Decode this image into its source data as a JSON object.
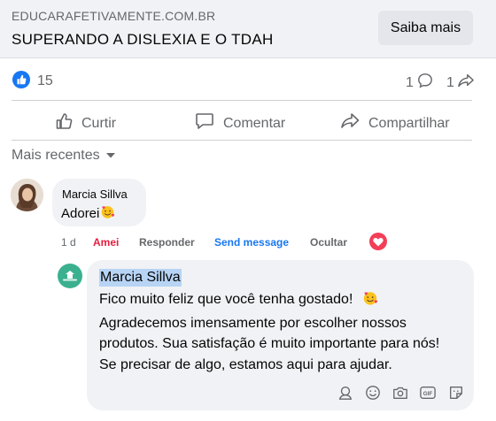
{
  "link_preview": {
    "domain": "EDUCARAFETIVAMENTE.COM.BR",
    "title": "SUPERANDO A DISLEXIA E O TDAH",
    "cta_label": "Saiba mais"
  },
  "stats": {
    "like_count": "15",
    "comment_count": "1",
    "share_count": "1"
  },
  "actions": {
    "like_label": "Curtir",
    "comment_label": "Comentar",
    "share_label": "Compartilhar"
  },
  "sort": {
    "label": "Mais recentes"
  },
  "comment": {
    "author": "Marcia Sillva",
    "text": "Adorei",
    "time": "1 d",
    "reaction_label": "Amei",
    "reply_label": "Responder",
    "send_message_label": "Send message",
    "hide_label": "Ocultar",
    "colors": {
      "reacted": "#e41e3f",
      "send_message": "#1877f2",
      "heart": "#f33e58"
    }
  },
  "reply": {
    "mention": "Marcia Sillva",
    "lines": [
      "Fico muito feliz que você tenha gostado!",
      "Agradecemos imensamente por escolher nossos",
      "produtos. Sua satisfação é muito importante para nós!",
      "Se precisar de algo, estamos aqui para ajudar."
    ],
    "composer_icons": [
      "avatar-sticker-icon",
      "emoji-icon",
      "camera-icon",
      "gif-icon",
      "sticker-icon"
    ]
  },
  "theme": {
    "accent": "#1877f2",
    "secondary_text": "#65676b",
    "bubble_bg": "#f0f2f5"
  }
}
